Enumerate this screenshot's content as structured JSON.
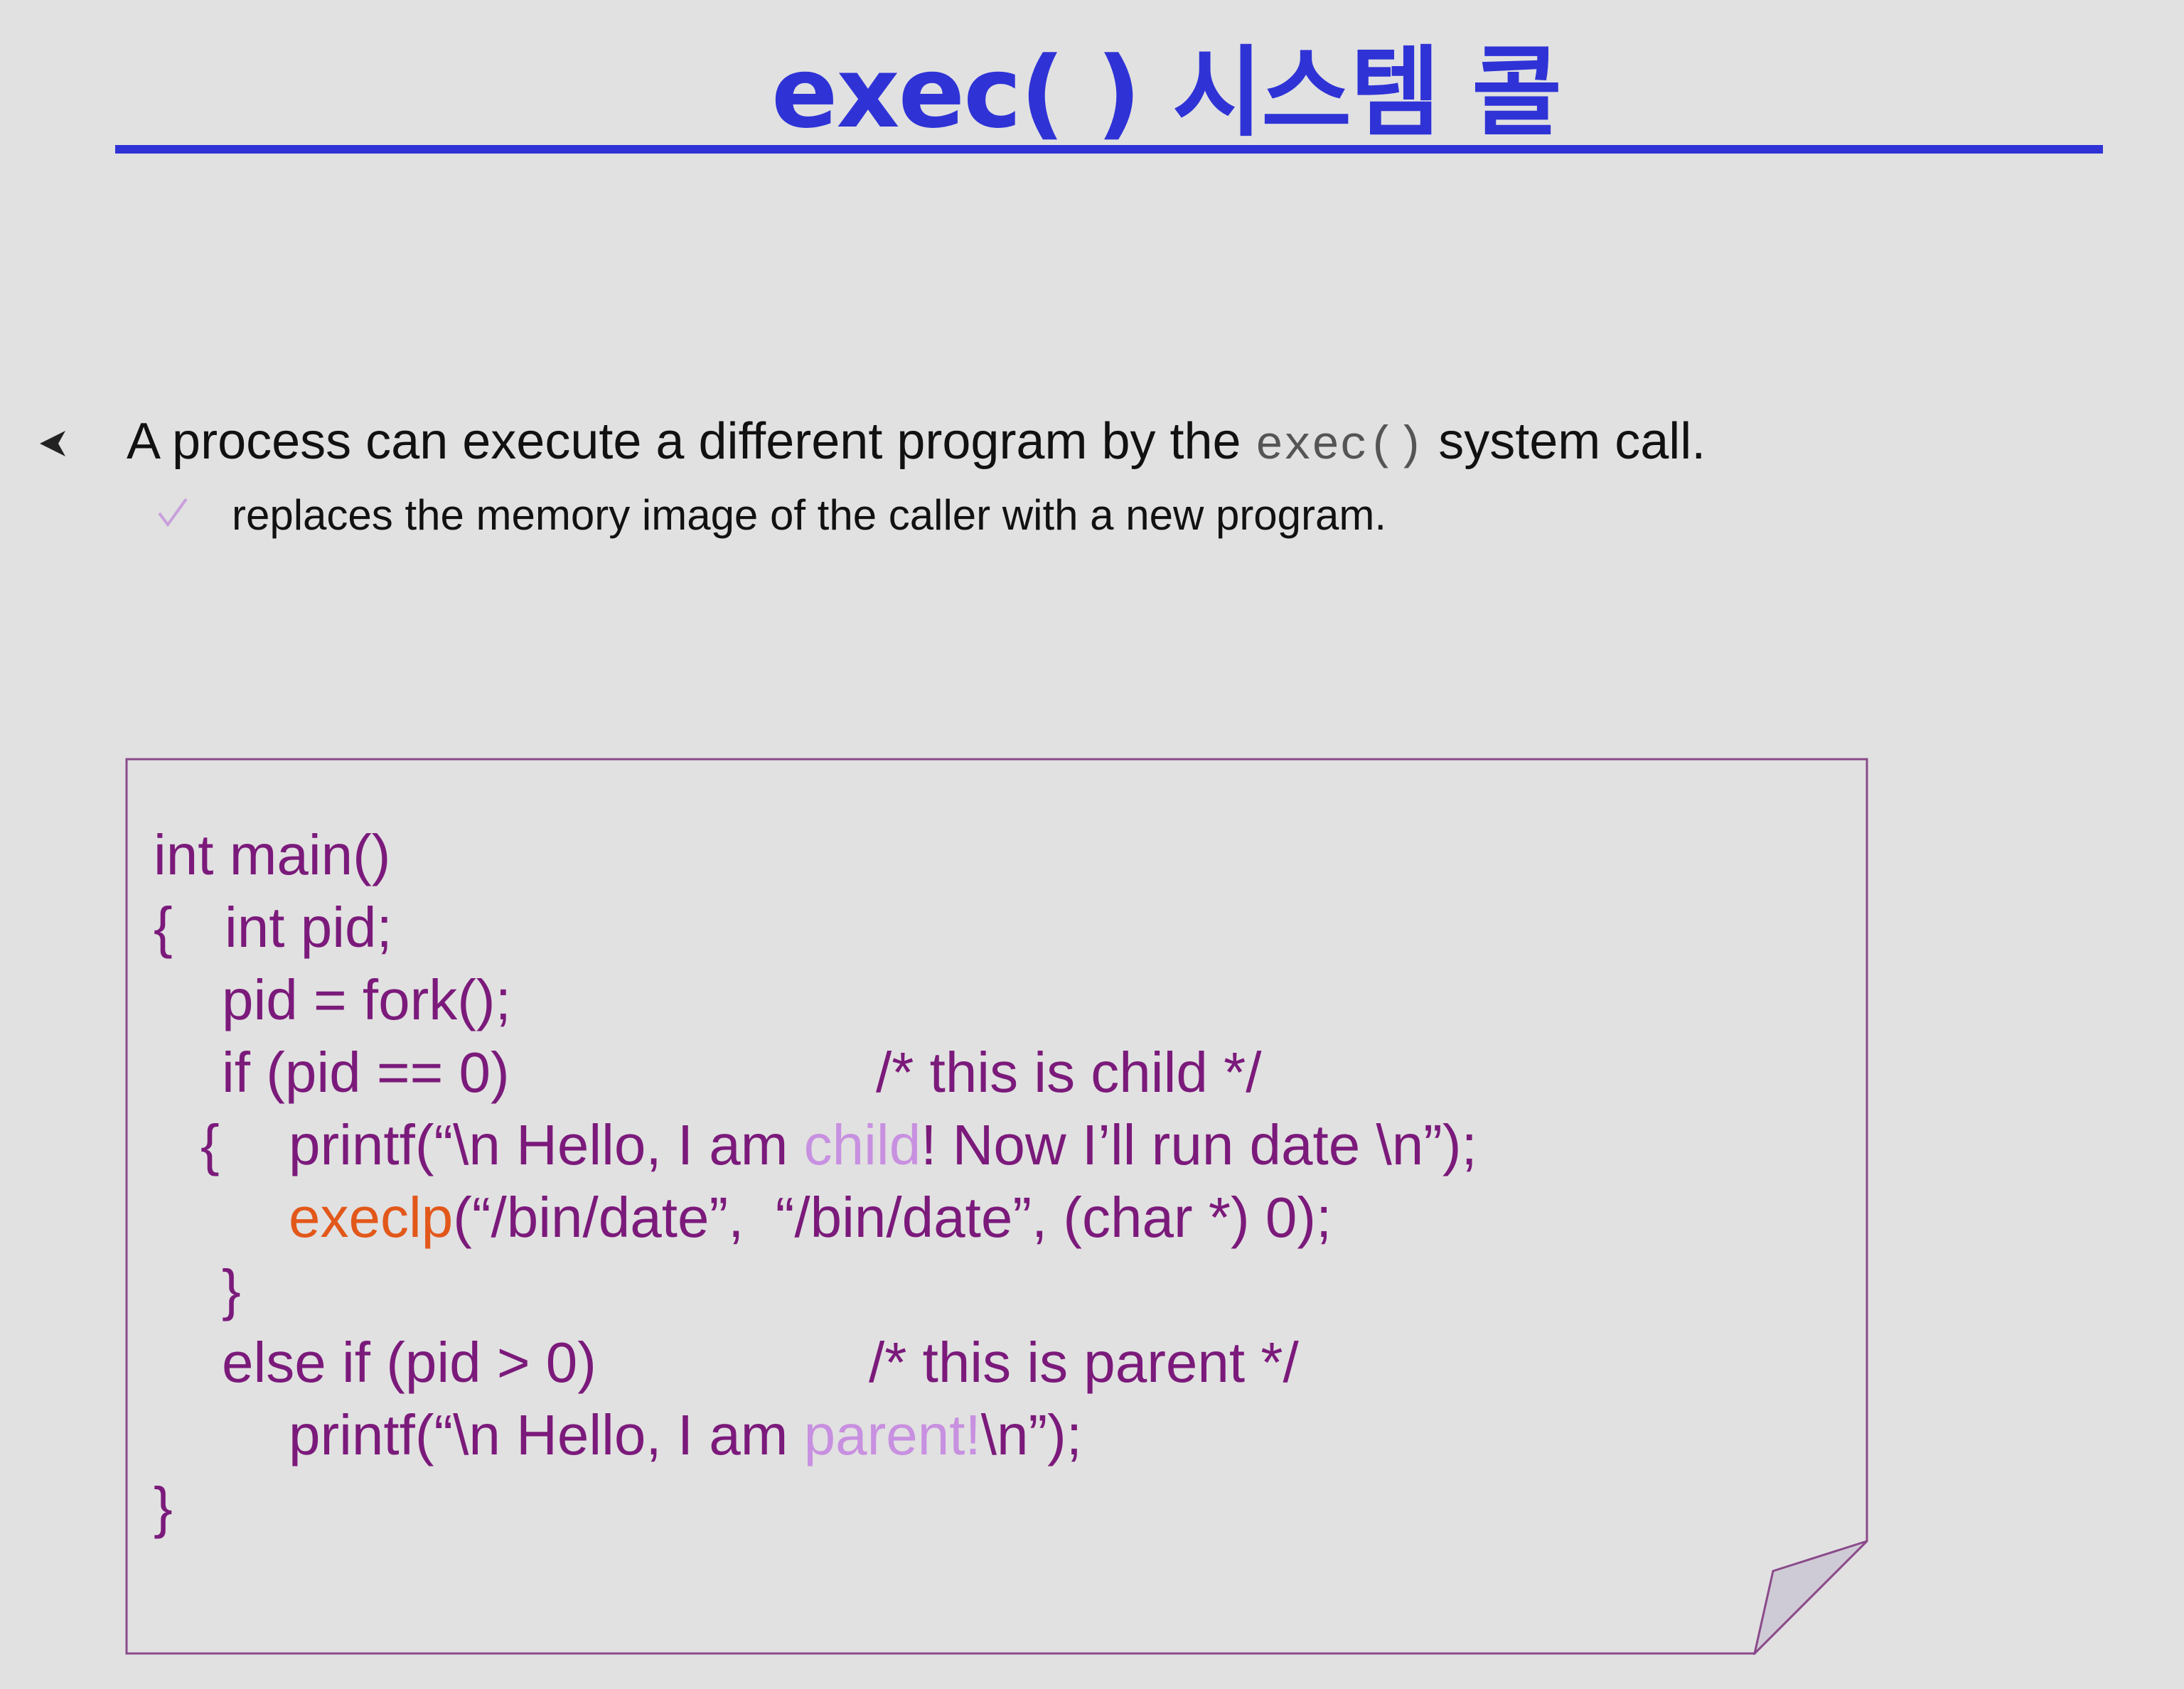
{
  "slide": {
    "title": "exec( ) 시스템 콜",
    "bullet": {
      "before": "A process can execute a different program by the ",
      "code": "exec()",
      "after": " system call."
    },
    "sub_bullet": "replaces the memory image of the caller with a new program."
  },
  "code_block": {
    "l1": "int main()",
    "l2a": "{",
    "l2b": "int pid;",
    "l3": "pid = fork();",
    "l4a": "if (pid == 0)",
    "l4b": "/* this is child */",
    "l5a": "{",
    "l5b": "printf(“\\n Hello, I am ",
    "l5c": "child",
    "l5d": "! Now I’ll run date \\n”);",
    "l6a": "execlp",
    "l6b": "(“/bin/date”,  “/bin/date”, (char *) 0);",
    "l7": "}",
    "l8a": "else if (pid > 0)",
    "l8b": "/* this is parent */",
    "l9a": "printf(“\\n Hello, I am ",
    "l9b": "parent!",
    "l9c": "\\n”);",
    "l10": "}"
  },
  "colors": {
    "title": "#2f33d6",
    "code": "#7b1a7b",
    "highlight": "#c890e0",
    "function": "#e2581a",
    "background": "#e1e1e1"
  }
}
